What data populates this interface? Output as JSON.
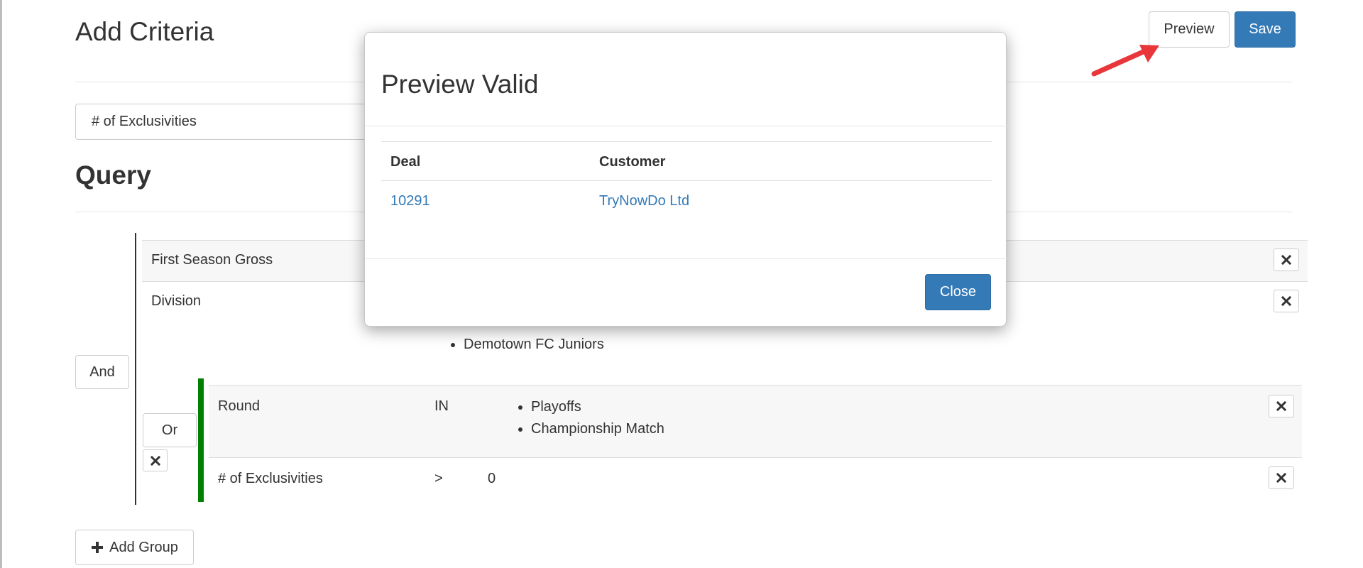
{
  "header": {
    "title": "Add Criteria",
    "preview_label": "Preview",
    "save_label": "Save"
  },
  "criteria_select": {
    "value": "# of Exclusivities"
  },
  "query": {
    "heading": "Query",
    "and_label": "And",
    "or_label": "Or",
    "rows": [
      {
        "field": "First Season Gross"
      },
      {
        "field": "Division",
        "values": [
          "Demotown FC Juniors"
        ]
      }
    ],
    "or_rows": [
      {
        "field": "Round",
        "operator": "IN",
        "values": [
          "Playoffs",
          "Championship Match"
        ]
      },
      {
        "field": "# of Exclusivities",
        "operator": ">",
        "value": "0"
      }
    ],
    "add_group_label": "Add Group"
  },
  "modal": {
    "title": "Preview Valid",
    "columns": [
      "Deal",
      "Customer"
    ],
    "rows": [
      {
        "deal": "10291",
        "customer": "TryNowDo Ltd"
      }
    ],
    "close_label": "Close"
  },
  "icons": {
    "remove": "close-icon",
    "add": "plus-icon",
    "annotation": "red-arrow-icon"
  },
  "colors": {
    "primary": "#337ab7",
    "link": "#337ab7",
    "group_bar": "#008000",
    "arrow": "#e8363a"
  }
}
